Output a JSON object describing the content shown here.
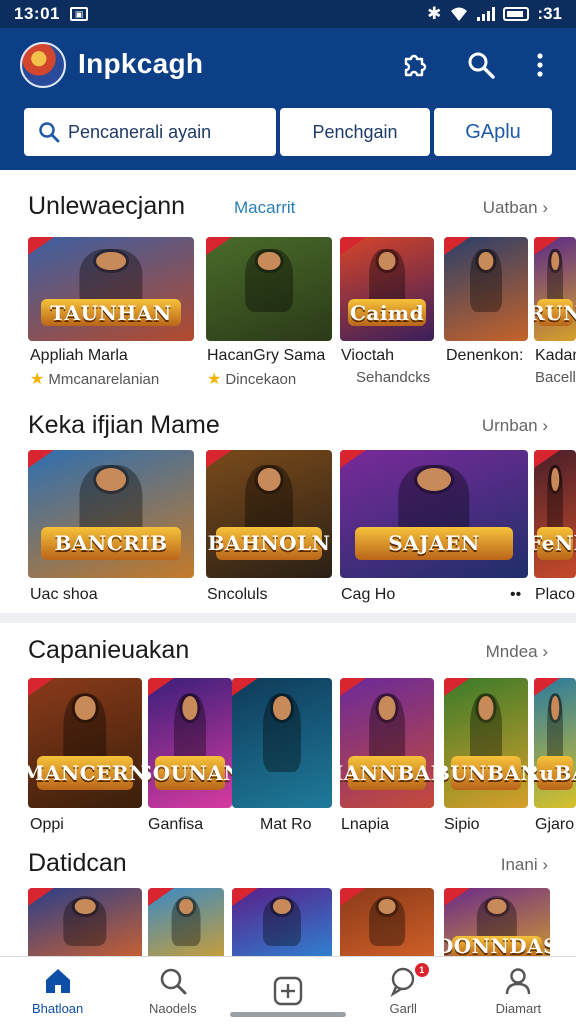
{
  "status": {
    "time": "13:01",
    "battery": ":31"
  },
  "header": {
    "title": "Inpkcagh",
    "search_placeholder": "Pencanerali ayain",
    "segment_mid": "Penchgain",
    "segment_right": "GAplu"
  },
  "sections": [
    {
      "title": "Unlewaecjann",
      "subtitle": "Macarrit",
      "more": "Uatban",
      "cards": [
        {
          "name": "Appliah Marla",
          "meta": "Mmcanarelanian",
          "star": true,
          "banner": "TAUNHAN",
          "colors": [
            "#3c5fa3",
            "#b34a2d"
          ]
        },
        {
          "name": "HacanGry Sama",
          "meta": "Dincekaon",
          "star": true,
          "banner": "",
          "colors": [
            "#4a6b2a",
            "#2b3a18"
          ]
        },
        {
          "name": "Vioctah",
          "meta": "Sehandcks",
          "star": false,
          "banner": "Caimd",
          "colors": [
            "#d6452a",
            "#3a1f5a"
          ]
        },
        {
          "name": "Denenkon:",
          "meta": "",
          "star": false,
          "banner": "",
          "colors": [
            "#2a3f6a",
            "#c6632a"
          ]
        },
        {
          "name": "Kadan",
          "meta": "Bacell",
          "star": false,
          "banner": "RUN",
          "colors": [
            "#5a2a8a",
            "#d6a02a"
          ]
        }
      ]
    },
    {
      "title": "Keka ifjian Mame",
      "subtitle": "",
      "more": "Urnban",
      "cards": [
        {
          "name": "Uac shoa",
          "meta": "",
          "star": false,
          "banner": "BANCRIB",
          "colors": [
            "#2f6fb0",
            "#c47a2a"
          ]
        },
        {
          "name": "Sncoluls",
          "meta": "",
          "star": false,
          "banner": "BAHNOLN",
          "colors": [
            "#7a4a1a",
            "#2a2016"
          ]
        },
        {
          "name": "Cag Ho",
          "meta": "",
          "star": false,
          "banner": "SAJAEN",
          "colors": [
            "#7a2a9a",
            "#1f2f6a"
          ]
        },
        {
          "name": "Placon",
          "meta": "",
          "star": false,
          "banner": "FeNl",
          "colors": [
            "#4a1f2a",
            "#c64a2a"
          ]
        }
      ]
    },
    {
      "title": "Capanieuakan",
      "subtitle": "",
      "more": "Mndea",
      "cards": [
        {
          "name": "Oppi",
          "meta": "",
          "star": false,
          "banner": "MANCERN",
          "colors": [
            "#8a3a1a",
            "#3a1f0a"
          ]
        },
        {
          "name": "Ganfisa",
          "meta": "",
          "star": false,
          "banner": "SOUNAN",
          "colors": [
            "#3a1f7a",
            "#d63aa0"
          ]
        },
        {
          "name": "Mat Ro",
          "meta": "",
          "star": false,
          "banner": "",
          "colors": [
            "#0f3a5a",
            "#1f7a9a"
          ]
        },
        {
          "name": "Lnapia",
          "meta": "",
          "star": false,
          "banner": "HANNBAN",
          "colors": [
            "#6a2a9a",
            "#c64a3a"
          ]
        },
        {
          "name": "Sipio",
          "meta": "",
          "star": false,
          "banner": "BUNBAN",
          "colors": [
            "#3a7a2a",
            "#d6a02a"
          ]
        },
        {
          "name": "Gjaro",
          "meta": "",
          "star": false,
          "banner": "RuBA",
          "colors": [
            "#2a7aa0",
            "#d6c22a"
          ]
        }
      ]
    },
    {
      "title": "Datidcan",
      "subtitle": "",
      "more": "Inani",
      "cards": [
        {
          "name": "",
          "meta": "",
          "star": false,
          "banner": "",
          "colors": [
            "#2a3f8a",
            "#d6632a"
          ]
        },
        {
          "name": "",
          "meta": "",
          "star": false,
          "banner": "",
          "colors": [
            "#3a8ac6",
            "#d6a02a"
          ]
        },
        {
          "name": "",
          "meta": "",
          "star": false,
          "banner": "",
          "colors": [
            "#5a1f8a",
            "#2a8ad6"
          ]
        },
        {
          "name": "",
          "meta": "",
          "star": false,
          "banner": "",
          "colors": [
            "#8a3a1a",
            "#d6632a"
          ]
        },
        {
          "name": "",
          "meta": "",
          "star": false,
          "banner": "DONNDAS",
          "colors": [
            "#6a2a8a",
            "#d6a02a"
          ]
        }
      ]
    }
  ],
  "nav": [
    {
      "label": "Bhatloan",
      "icon": "home-icon",
      "active": true
    },
    {
      "label": "Naodels",
      "icon": "search-icon",
      "active": false
    },
    {
      "label": "",
      "icon": "add-icon",
      "active": false
    },
    {
      "label": "Garll",
      "icon": "chat-icon",
      "active": false,
      "badge": "1"
    },
    {
      "label": "Diamart",
      "icon": "profile-icon",
      "active": false
    }
  ],
  "accent": "#0c3f86"
}
